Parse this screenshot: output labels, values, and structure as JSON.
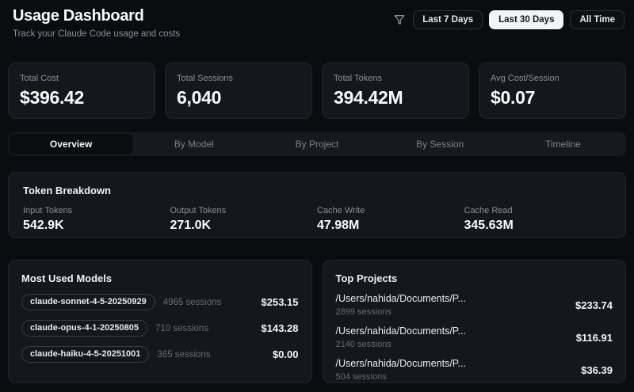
{
  "header": {
    "title": "Usage Dashboard",
    "subtitle": "Track your Claude Code usage and costs",
    "filters": [
      {
        "label": "Last 7 Days",
        "active": false
      },
      {
        "label": "Last 30 Days",
        "active": true
      },
      {
        "label": "All Time",
        "active": false
      }
    ]
  },
  "stats": [
    {
      "label": "Total Cost",
      "value": "$396.42"
    },
    {
      "label": "Total Sessions",
      "value": "6,040"
    },
    {
      "label": "Total Tokens",
      "value": "394.42M"
    },
    {
      "label": "Avg Cost/Session",
      "value": "$0.07"
    }
  ],
  "tabs": [
    {
      "label": "Overview",
      "active": true
    },
    {
      "label": "By Model",
      "active": false
    },
    {
      "label": "By Project",
      "active": false
    },
    {
      "label": "By Session",
      "active": false
    },
    {
      "label": "Timeline",
      "active": false
    }
  ],
  "token_breakdown": {
    "title": "Token Breakdown",
    "items": [
      {
        "label": "Input Tokens",
        "value": "542.9K"
      },
      {
        "label": "Output Tokens",
        "value": "271.0K"
      },
      {
        "label": "Cache Write",
        "value": "47.98M"
      },
      {
        "label": "Cache Read",
        "value": "345.63M"
      }
    ]
  },
  "models": {
    "title": "Most Used Models",
    "rows": [
      {
        "name": "claude-sonnet-4-5-20250929",
        "sessions": "4965 sessions",
        "cost": "$253.15"
      },
      {
        "name": "claude-opus-4-1-20250805",
        "sessions": "710 sessions",
        "cost": "$143.28"
      },
      {
        "name": "claude-haiku-4-5-20251001",
        "sessions": "365 sessions",
        "cost": "$0.00"
      }
    ]
  },
  "projects": {
    "title": "Top Projects",
    "rows": [
      {
        "path": "/Users/nahida/Documents/P...",
        "sessions": "2899 sessions",
        "cost": "$233.74"
      },
      {
        "path": "/Users/nahida/Documents/P...",
        "sessions": "2140 sessions",
        "cost": "$116.91"
      },
      {
        "path": "/Users/nahida/Documents/P...",
        "sessions": "504 sessions",
        "cost": "$36.39"
      }
    ]
  },
  "icons": {
    "filter": "funnel-icon"
  },
  "colors": {
    "page_bg": "#0a0c0f",
    "panel_bg": "#14171b",
    "panel_border": "#23272c",
    "tabbar_bg": "#16191e",
    "muted_text": "#8a9097",
    "dim_text": "#676d74",
    "active_filter_bg": "#f3f4f5",
    "active_filter_text": "#141517"
  }
}
